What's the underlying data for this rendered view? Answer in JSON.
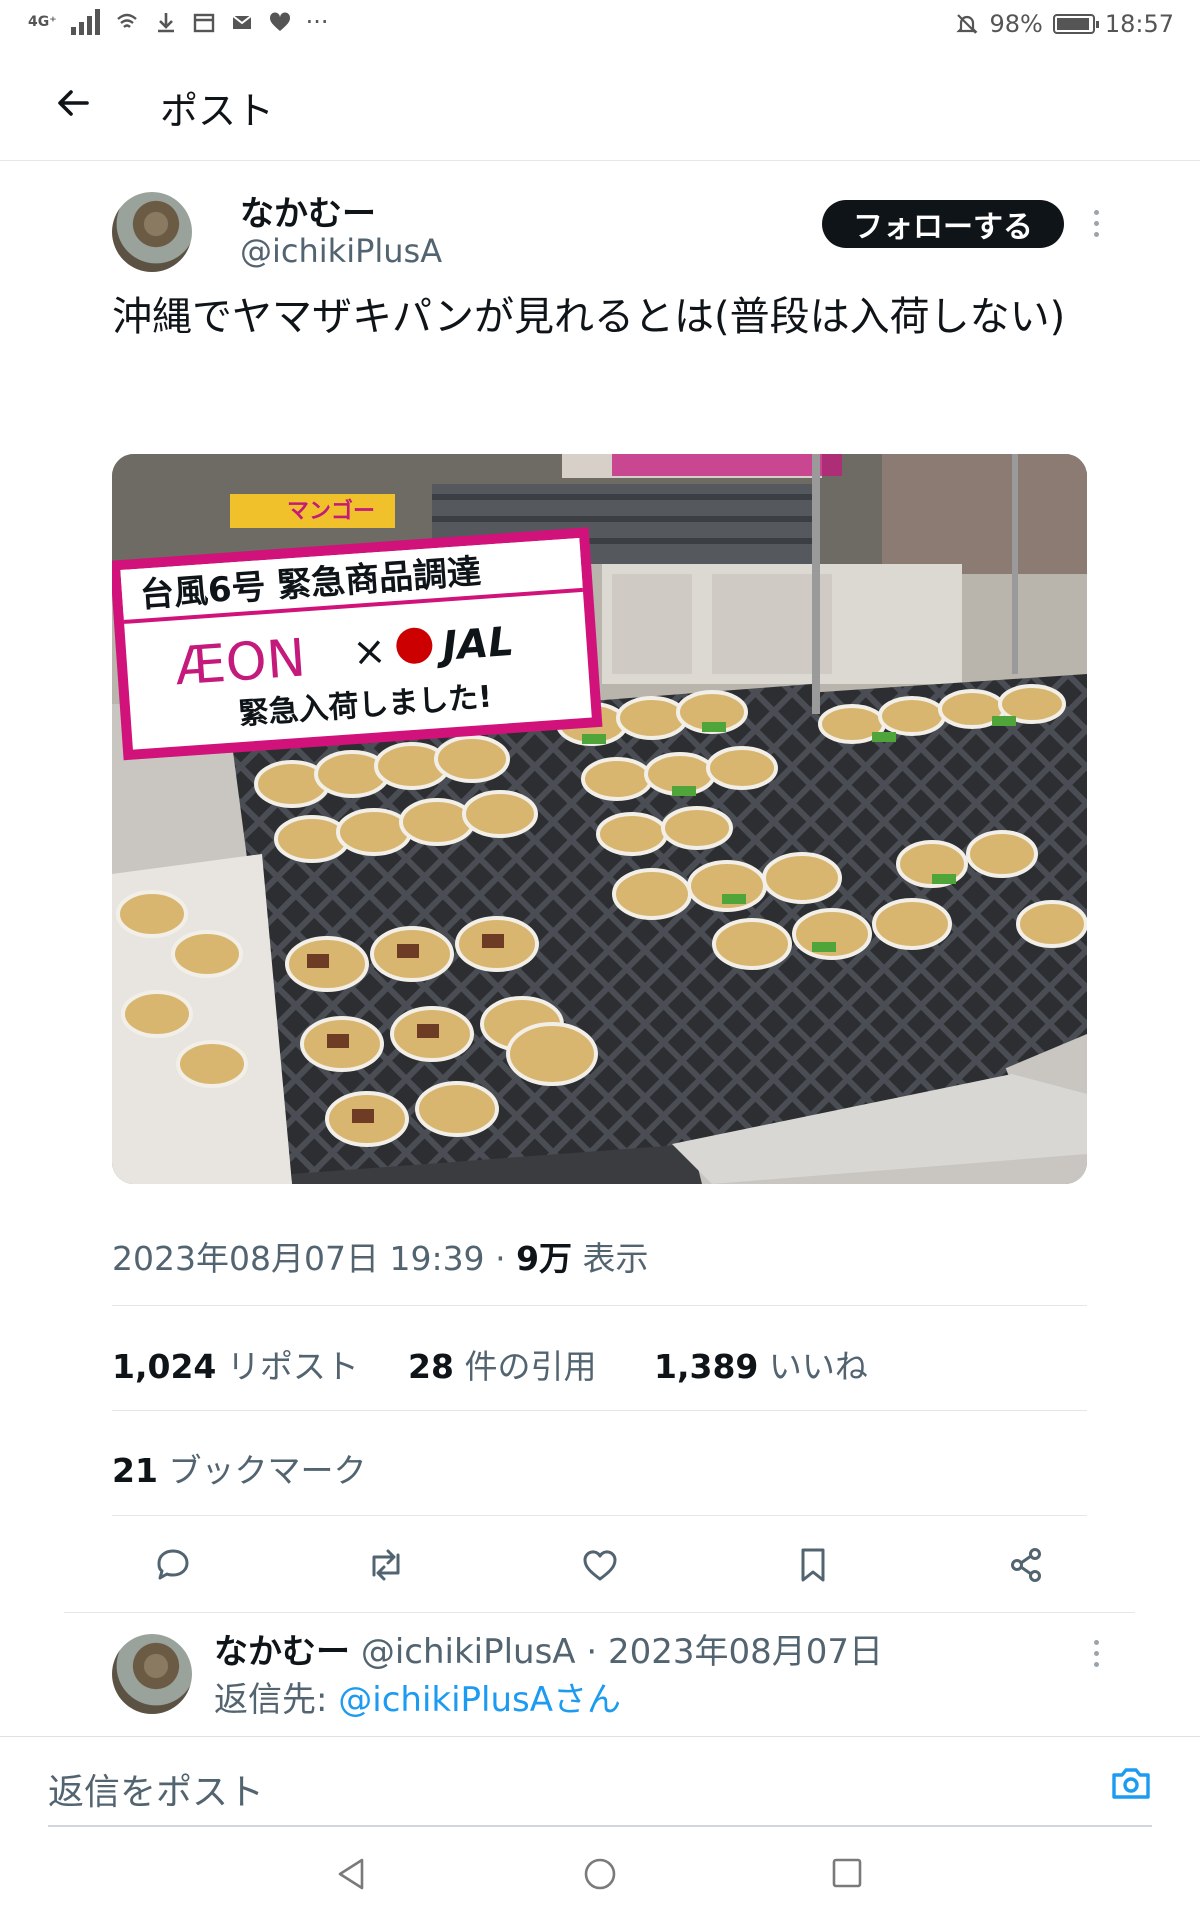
{
  "status_bar": {
    "network": "4G⁺",
    "battery": "98%",
    "time": "18:57",
    "icons": [
      "signal-icon",
      "wifi-calling-icon",
      "download-icon",
      "calendar-icon",
      "mail-icon",
      "heart-icon",
      "more-icon",
      "mute-icon",
      "battery-icon"
    ]
  },
  "header": {
    "title": "ポスト"
  },
  "post": {
    "author_name": "なかむー",
    "author_handle": "@ichikiPlusA",
    "follow_label": "フォローする",
    "text": "沖縄でヤマザキパンが見れるとは(普段は入荷しない)",
    "image": {
      "sign_line1": "台風6号 緊急商品調達",
      "sign_brand1": "ÆON",
      "sign_x": "×",
      "sign_brand2": "JAL",
      "sign_line3": "緊急入荷しました!",
      "sign_small": "マンゴー"
    },
    "date": "2023年08月07日 19:39",
    "sep": "·",
    "views_count": "9万",
    "views_label": "表示",
    "stats": {
      "reposts_count": "1,024",
      "reposts_label": "リポスト",
      "quotes_count": "28",
      "quotes_label": "件の引用",
      "likes_count": "1,389",
      "likes_label": "いいね",
      "bookmarks_count": "21",
      "bookmarks_label": "ブックマーク"
    }
  },
  "reply": {
    "author_name": "なかむー",
    "meta": "@ichikiPlusA · 2023年08月07日",
    "reply_to_label": "返信先:",
    "reply_to_handle": "@ichikiPlusAさん"
  },
  "compose": {
    "placeholder": "返信をポスト"
  },
  "colors": {
    "accent": "#1d9bf0",
    "text": "#0f1419",
    "muted": "#536471",
    "sign_magenta": "#d0127a"
  }
}
